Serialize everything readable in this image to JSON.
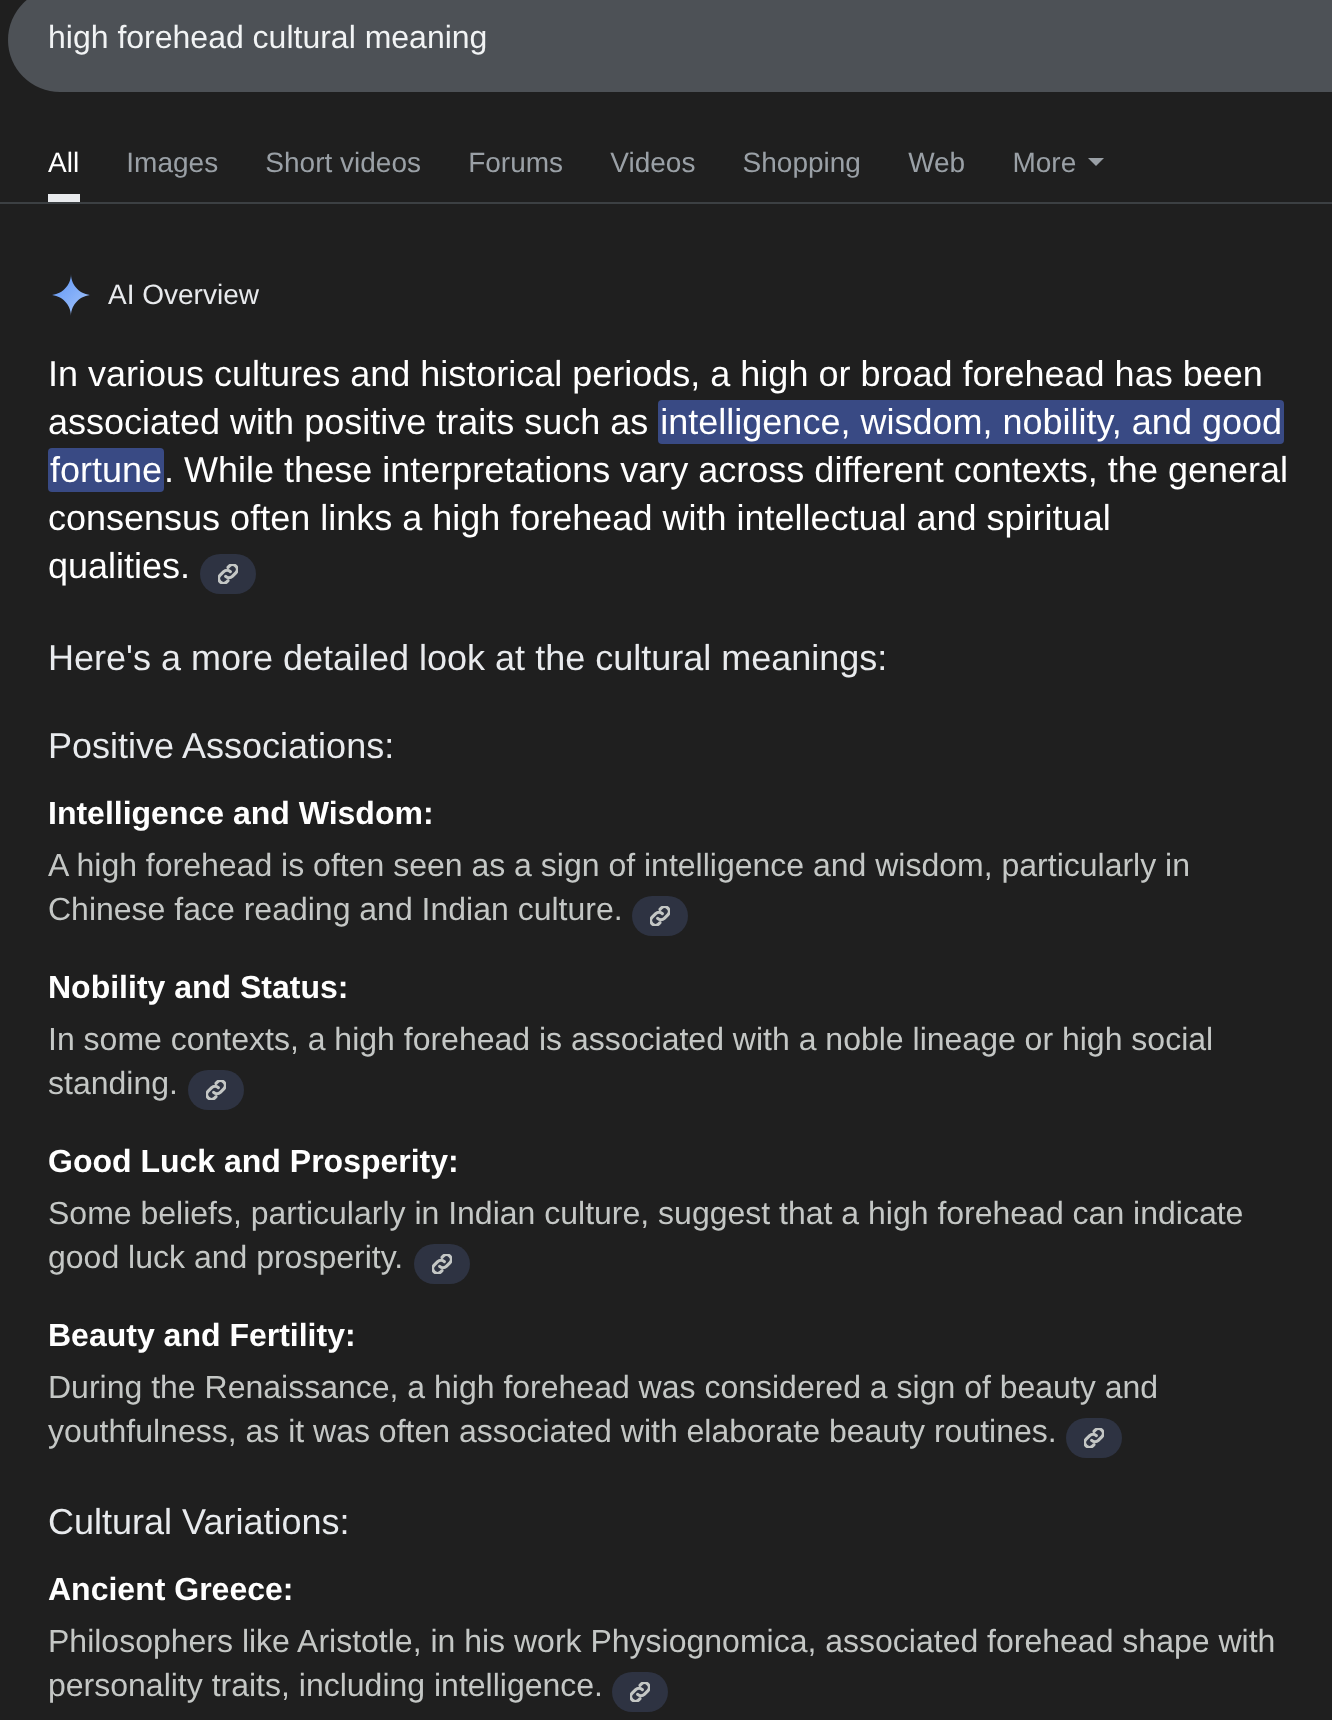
{
  "search": {
    "value": "high forehead cultural meaning"
  },
  "tabs": [
    {
      "label": "All",
      "selected": true,
      "kind": "link"
    },
    {
      "label": "Images",
      "selected": false,
      "kind": "link"
    },
    {
      "label": "Short videos",
      "selected": false,
      "kind": "link"
    },
    {
      "label": "Forums",
      "selected": false,
      "kind": "link"
    },
    {
      "label": "Videos",
      "selected": false,
      "kind": "link"
    },
    {
      "label": "Shopping",
      "selected": false,
      "kind": "link"
    },
    {
      "label": "Web",
      "selected": false,
      "kind": "link"
    },
    {
      "label": "More",
      "selected": false,
      "kind": "menu"
    }
  ],
  "ai_overview": {
    "title": "AI Overview",
    "summary": [
      {
        "text": "In various cultures and historical periods, a high or broad forehead has been associated with positive traits such as ",
        "highlighted": false
      },
      {
        "text": "intelligence, wisdom, nobility, and good fortune",
        "highlighted": true
      },
      {
        "text": ". While these interpretations vary across different contexts, the general consensus often links a high forehead with intellectual and spiritual qualities.",
        "highlighted": false
      }
    ],
    "intro": "Here's a more detailed look at the cultural meanings:",
    "sections": [
      {
        "heading": "Positive Associations:",
        "items": [
          {
            "title": "Intelligence and Wisdom:",
            "text": "A high forehead is often seen as a sign of intelligence and wisdom, particularly in Chinese face reading and Indian culture."
          },
          {
            "title": "Nobility and Status:",
            "text": "In some contexts, a high forehead is associated with a noble lineage or high social standing."
          },
          {
            "title": "Good Luck and Prosperity:",
            "text": "Some beliefs, particularly in Indian culture, suggest that a high forehead can indicate good luck and prosperity."
          },
          {
            "title": "Beauty and Fertility:",
            "text": "During the Renaissance, a high forehead was considered a sign of beauty and youthfulness, as it was often associated with elaborate beauty routines."
          }
        ]
      },
      {
        "heading": "Cultural Variations:",
        "items": [
          {
            "title": "Ancient Greece:",
            "text": "Philosophers like Aristotle, in his work Physiognomica, associated forehead shape with personality traits, including intelligence."
          }
        ]
      }
    ]
  }
}
